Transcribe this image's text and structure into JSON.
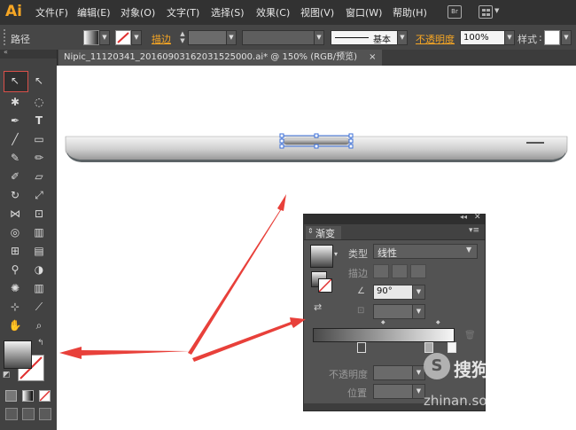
{
  "app": {
    "logo": "Ai"
  },
  "menu": {
    "items": [
      "文件(F)",
      "编辑(E)",
      "对象(O)",
      "文字(T)",
      "选择(S)",
      "效果(C)",
      "视图(V)",
      "窗口(W)",
      "帮助(H)"
    ],
    "br_icon": "Br"
  },
  "control": {
    "selection_label": "路径",
    "stroke_label": "描边",
    "stroke_style": "基本",
    "opacity_label": "不透明度",
    "opacity_value": "100%",
    "style_label": "样式"
  },
  "document": {
    "tab_title": "Nipic_11120341_20160903162031525000.ai*  @  150%  (RGB/预览)",
    "close_glyph": "×"
  },
  "gradient_panel": {
    "title": "渐变",
    "type_label": "类型",
    "type_value": "线性",
    "stroke_label": "描边",
    "angle_value": "90°",
    "opacity_label": "不透明度",
    "position_label": "位置"
  },
  "watermark": {
    "brand": "搜狗指南",
    "url": "zhinan.sogou.com"
  },
  "colors": {
    "accent": "#f6a624",
    "arrow": "#e8403a",
    "selection": "#3b6fd8"
  }
}
